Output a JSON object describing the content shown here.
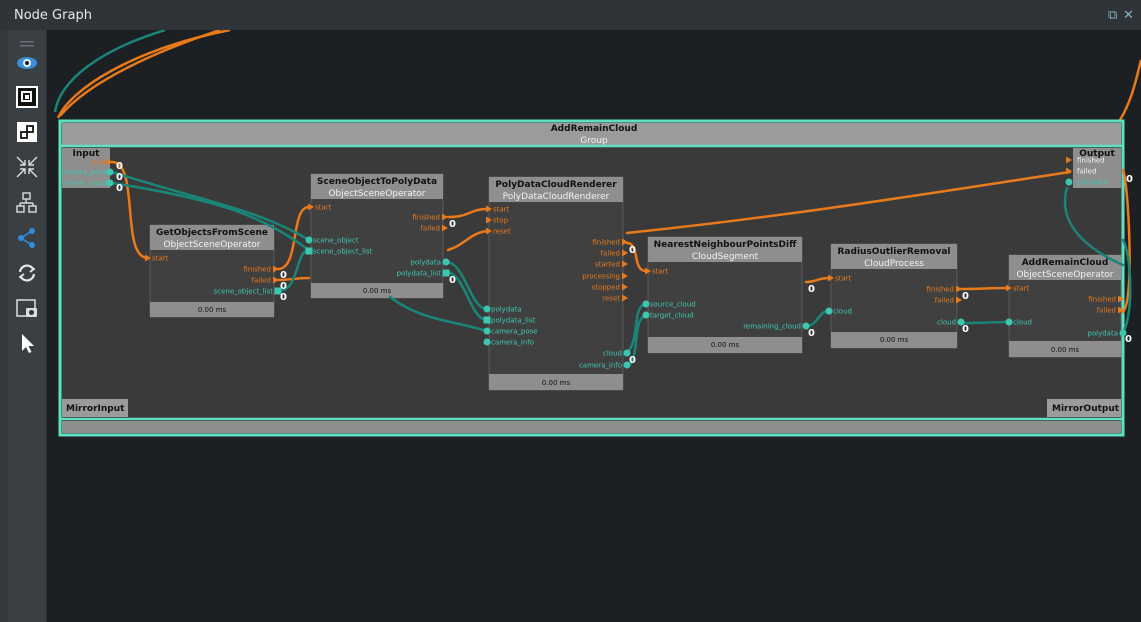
{
  "window": {
    "title": "Node Graph",
    "restore_glyph": "⧉",
    "close_glyph": "✕"
  },
  "toolbar": {
    "icons": [
      "menu-icon",
      "eye-icon",
      "frame-icon",
      "group-icon",
      "collapse-icon",
      "layout-icon",
      "connections-icon",
      "refresh-icon",
      "screenshot-icon",
      "pointer-icon"
    ]
  },
  "colors": {
    "accent": "#5fe0c2",
    "orange": "#e87a1c",
    "teal": "#1a8577",
    "node_header": "#8e8e8e",
    "node_body": "#404040",
    "group_body": "#3a3a3a"
  },
  "group": {
    "title": "AddRemainCloud",
    "subtitle": "Group",
    "mirror_input": "MirrorInput",
    "mirror_output": "MirrorOutput",
    "input": {
      "title": "Input",
      "ports": [
        "start",
        "camera_pose",
        "scene_cloud"
      ],
      "counts": [
        "0",
        "0",
        "0"
      ]
    },
    "output": {
      "title": "Output",
      "ports": [
        "finished",
        "failed",
        "polydata"
      ],
      "counts": [
        "0",
        "0"
      ]
    }
  },
  "nodes": [
    {
      "title": "GetObjectsFromScene",
      "type": "ObjectSceneOperator",
      "inputs": [
        "start"
      ],
      "outputs": [
        "finished",
        "failed",
        "scene_object_list"
      ],
      "counts": [
        "0",
        "0",
        "0"
      ],
      "timing": "0.00 ms"
    },
    {
      "title": "SceneObjectToPolyData",
      "type": "ObjectSceneOperator",
      "inputs": [
        "start",
        "scene_object",
        "scene_object_list"
      ],
      "outputs": [
        "finished",
        "failed",
        "polydata",
        "polydata_list"
      ],
      "counts": [
        "0",
        "0"
      ],
      "timing": "0.00 ms"
    },
    {
      "title": "PolyDataCloudRenderer",
      "type": "PolyDataCloudRenderer",
      "inputs": [
        "start",
        "stop",
        "reset",
        "polydata",
        "polydata_list",
        "camera_pose",
        "camera_info"
      ],
      "outputs": [
        "finished",
        "failed",
        "started",
        "processing",
        "stopped",
        "reset",
        "cloud",
        "camera_info"
      ],
      "counts": [
        "0",
        "0"
      ],
      "timing": "0.00 ms"
    },
    {
      "title": "NearestNeighbourPointsDiff",
      "type": "CloudSegment",
      "inputs": [
        "start",
        "source_cloud",
        "target_cloud"
      ],
      "outputs": [
        "remaining_cloud"
      ],
      "counts": [
        "0"
      ],
      "timing": "0.00 ms"
    },
    {
      "title": "RadiusOutlierRemoval",
      "type": "CloudProcess",
      "inputs": [
        "start",
        "cloud"
      ],
      "outputs": [
        "finished",
        "failed",
        "cloud"
      ],
      "counts": [
        "0",
        "0"
      ],
      "timing": "0.00 ms"
    },
    {
      "title": "AddRemainCloud",
      "type": "ObjectSceneOperator",
      "inputs": [
        "start",
        "cloud"
      ],
      "outputs": [
        "finished",
        "failed",
        "polydata"
      ],
      "counts": [
        "0"
      ],
      "timing": "0.00 ms"
    }
  ]
}
